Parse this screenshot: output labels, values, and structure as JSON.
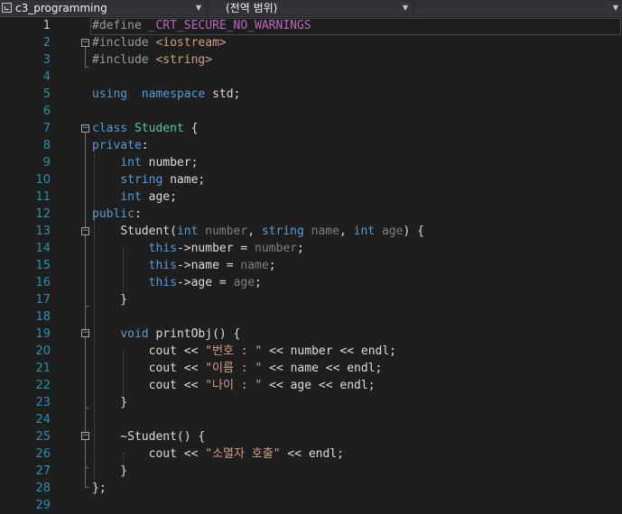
{
  "nav": {
    "project": "c3_programming",
    "scope": "(전역 범위)",
    "member": ""
  },
  "editor": {
    "lines": [
      {
        "n": "1",
        "t": [
          [
            "pp",
            "#define "
          ],
          [
            "mac",
            "_CRT_SECURE_NO_WARNINGS"
          ]
        ]
      },
      {
        "n": "2",
        "t": [
          [
            "pp",
            "#include "
          ],
          [
            "str",
            "<iostream>"
          ]
        ]
      },
      {
        "n": "3",
        "t": [
          [
            "pp",
            "#include "
          ],
          [
            "str",
            "<string>"
          ]
        ]
      },
      {
        "n": "4",
        "t": []
      },
      {
        "n": "5",
        "t": [
          [
            "kw",
            "using"
          ],
          [
            "",
            "  "
          ],
          [
            "kw",
            "namespace"
          ],
          [
            "",
            " std;"
          ]
        ]
      },
      {
        "n": "6",
        "t": []
      },
      {
        "n": "7",
        "t": [
          [
            "kw",
            "class"
          ],
          [
            "",
            " "
          ],
          [
            "cls",
            "Student"
          ],
          [
            "",
            " {"
          ]
        ]
      },
      {
        "n": "8",
        "t": [
          [
            "kw",
            "private"
          ],
          [
            "",
            ":"
          ]
        ]
      },
      {
        "n": "9",
        "t": [
          [
            "",
            "    "
          ],
          [
            "kw",
            "int"
          ],
          [
            "",
            " number;"
          ]
        ]
      },
      {
        "n": "10",
        "t": [
          [
            "",
            "    "
          ],
          [
            "kw",
            "string"
          ],
          [
            "",
            " name;"
          ]
        ]
      },
      {
        "n": "11",
        "t": [
          [
            "",
            "    "
          ],
          [
            "kw",
            "int"
          ],
          [
            "",
            " age;"
          ]
        ]
      },
      {
        "n": "12",
        "t": [
          [
            "kw",
            "public"
          ],
          [
            "",
            ":"
          ]
        ]
      },
      {
        "n": "13",
        "t": [
          [
            "",
            "    "
          ],
          [
            "",
            "Student("
          ],
          [
            "kw",
            "int"
          ],
          [
            "",
            " "
          ],
          [
            "prm",
            "number"
          ],
          [
            "",
            ", "
          ],
          [
            "kw",
            "string"
          ],
          [
            "",
            " "
          ],
          [
            "prm",
            "name"
          ],
          [
            "",
            ", "
          ],
          [
            "kw",
            "int"
          ],
          [
            "",
            " "
          ],
          [
            "prm",
            "age"
          ],
          [
            "",
            ") {"
          ]
        ]
      },
      {
        "n": "14",
        "t": [
          [
            "",
            "        "
          ],
          [
            "kw",
            "this"
          ],
          [
            "",
            "->number = "
          ],
          [
            "prm",
            "number"
          ],
          [
            "",
            ";"
          ]
        ]
      },
      {
        "n": "15",
        "t": [
          [
            "",
            "        "
          ],
          [
            "kw",
            "this"
          ],
          [
            "",
            "->name = "
          ],
          [
            "prm",
            "name"
          ],
          [
            "",
            ";"
          ]
        ]
      },
      {
        "n": "16",
        "t": [
          [
            "",
            "        "
          ],
          [
            "kw",
            "this"
          ],
          [
            "",
            "->age = "
          ],
          [
            "prm",
            "age"
          ],
          [
            "",
            ";"
          ]
        ]
      },
      {
        "n": "17",
        "t": [
          [
            "",
            "    }"
          ]
        ]
      },
      {
        "n": "18",
        "t": []
      },
      {
        "n": "19",
        "t": [
          [
            "",
            "    "
          ],
          [
            "kw",
            "void"
          ],
          [
            "",
            " printObj() {"
          ]
        ]
      },
      {
        "n": "20",
        "t": [
          [
            "",
            "        cout << "
          ],
          [
            "str",
            "\"번호 : \""
          ],
          [
            "",
            " << number << endl;"
          ]
        ]
      },
      {
        "n": "21",
        "t": [
          [
            "",
            "        cout << "
          ],
          [
            "str",
            "\"이름 : \""
          ],
          [
            "",
            " << name << endl;"
          ]
        ]
      },
      {
        "n": "22",
        "t": [
          [
            "",
            "        cout << "
          ],
          [
            "str",
            "\"나이 : \""
          ],
          [
            "",
            " << age << endl;"
          ]
        ]
      },
      {
        "n": "23",
        "t": [
          [
            "",
            "    }"
          ]
        ]
      },
      {
        "n": "24",
        "t": []
      },
      {
        "n": "25",
        "t": [
          [
            "",
            "    ~Student() {"
          ]
        ]
      },
      {
        "n": "26",
        "t": [
          [
            "",
            "        cout << "
          ],
          [
            "str",
            "\"소멸자 호출\""
          ],
          [
            "",
            " << endl;"
          ]
        ]
      },
      {
        "n": "27",
        "t": [
          [
            "",
            "    }"
          ]
        ]
      },
      {
        "n": "28",
        "t": [
          [
            "",
            "};"
          ]
        ]
      },
      {
        "n": "29",
        "t": []
      }
    ]
  }
}
